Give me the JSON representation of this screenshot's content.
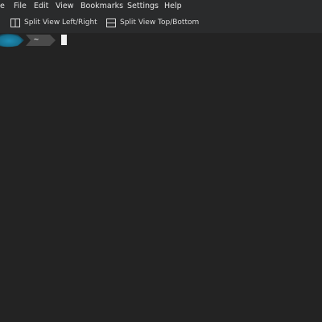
{
  "menubar": {
    "app_fragment": "e",
    "items": [
      {
        "label": "File"
      },
      {
        "label": "Edit"
      },
      {
        "label": "View"
      },
      {
        "label": "Bookmarks"
      },
      {
        "label": "Settings"
      },
      {
        "label": "Help"
      }
    ]
  },
  "toolbar": {
    "split_lr_label": "Split View Left/Right",
    "split_tb_label": "Split View Top/Bottom",
    "split_lr_icon": "split-horizontal-icon",
    "split_tb_icon": "split-vertical-icon"
  },
  "terminal": {
    "prompt_dir": "~",
    "colors": {
      "background": "#232323",
      "prompt_accent": "#1e8cb4",
      "prompt_dir_bg": "#4a4a4a",
      "cursor": "#f2f2f2"
    }
  }
}
